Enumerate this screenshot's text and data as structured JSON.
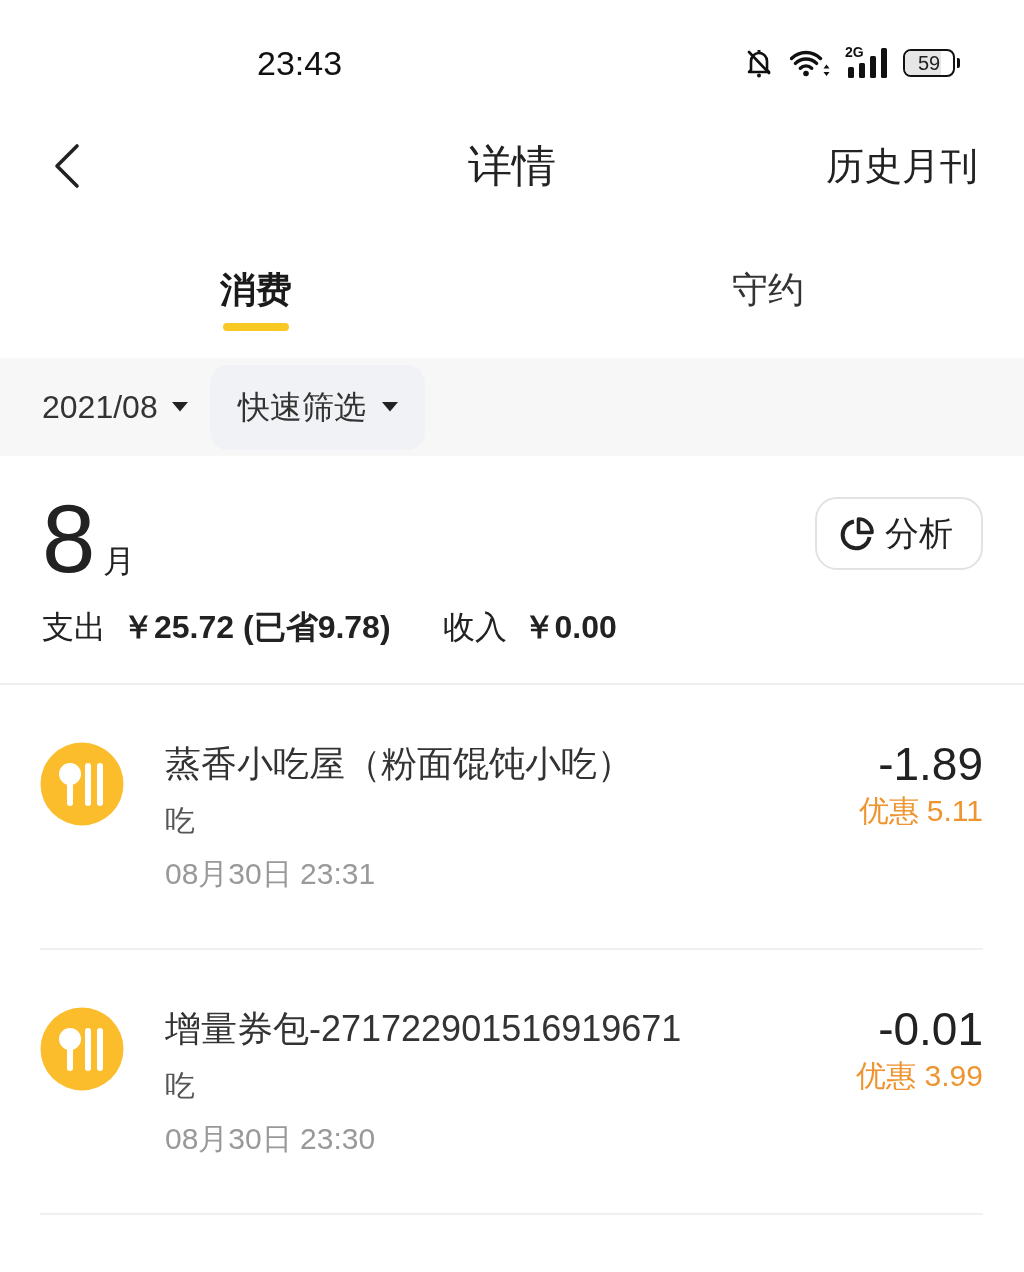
{
  "status_bar": {
    "time": "23:43",
    "network": "2G",
    "battery": "59"
  },
  "nav": {
    "title": "详情",
    "action": "历史月刊"
  },
  "tabs": [
    {
      "label": "消费",
      "selected": true
    },
    {
      "label": "守约",
      "selected": false
    }
  ],
  "filters": [
    {
      "label": "2021/08",
      "kind": "plain"
    },
    {
      "label": "快速筛选",
      "kind": "chip"
    }
  ],
  "summary": {
    "month_number": "8",
    "month_unit": "月",
    "analysis_button": "分析",
    "expense_label": "支出",
    "expense_value": "￥25.72 (已省9.78)",
    "income_label": "收入",
    "income_value": "￥0.00"
  },
  "transactions": [
    {
      "merchant": "蒸香小吃屋（粉面馄饨小吃）",
      "category": "吃",
      "time": "08月30日 23:31",
      "amount": "-1.89",
      "discount": "优惠 5.11"
    },
    {
      "merchant": "增量券包-271722901516919671",
      "category": "吃",
      "time": "08月30日 23:30",
      "amount": "-0.01",
      "discount": "优惠 3.99"
    }
  ]
}
